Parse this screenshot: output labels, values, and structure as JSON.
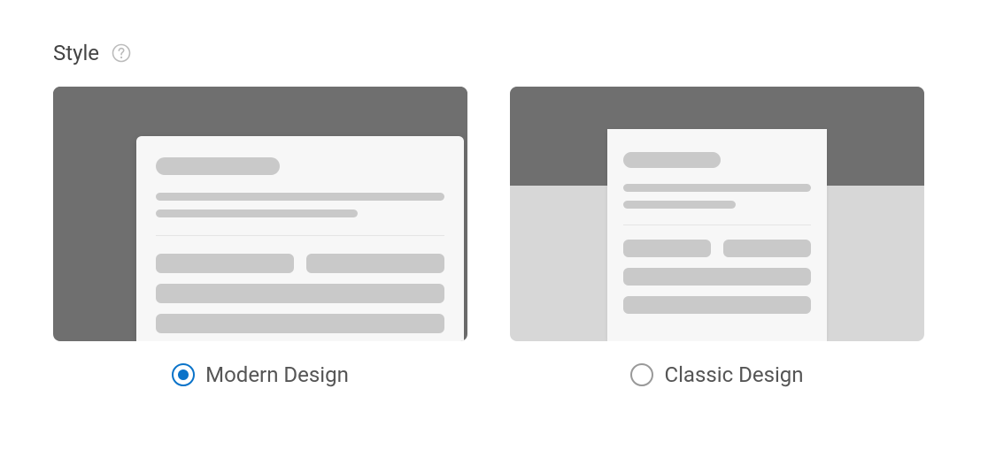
{
  "heading": "Style",
  "options": {
    "modern": {
      "label": "Modern Design",
      "selected": true
    },
    "classic": {
      "label": "Classic Design",
      "selected": false
    }
  }
}
